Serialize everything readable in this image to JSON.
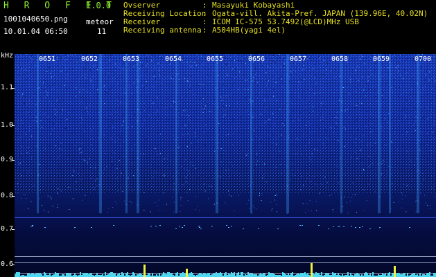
{
  "header_left": {
    "app_title": "H R O F F T",
    "app_version": "1.0.0",
    "file_name": "1001040650.png",
    "meteor_label": "meteor",
    "timestamp": "10.01.04 06:50",
    "meteor_count": "11"
  },
  "header_right": [
    {
      "key": "Ovserver",
      "value": "Masayuki Kobayashi"
    },
    {
      "key": "Receiving Location",
      "value": "Ogata-vill. Akita-Pref. JAPAN (139.96E, 40.02N)"
    },
    {
      "key": "Receiver",
      "value": "ICOM IC-575 53.7492(@LCD)MHz USB"
    },
    {
      "key": "Receiving antenna",
      "value": "A504HB(yagi 4el)"
    }
  ],
  "y_axis": {
    "unit": "kHz",
    "ticks": [
      "1.1",
      "1.0",
      "0.9",
      "0.8",
      "0.7",
      "0.6"
    ]
  },
  "time_axis": {
    "ticks": [
      "0651",
      "0652",
      "0653",
      "0654",
      "0655",
      "0656",
      "0657",
      "0658",
      "0659",
      "0700"
    ]
  },
  "colors": {
    "title_green": "#8ff02e",
    "header_yellow": "#e6e020",
    "spectrum_deep": "#00105a",
    "spectrum_mid": "#1030d0",
    "spectrum_bright": "#30c0ff",
    "echo_yellow": "#f0f040"
  },
  "meteor_echoes": [
    {
      "time": "0653",
      "strength": 0.9
    },
    {
      "time": "0654",
      "strength": 0.6
    },
    {
      "time": "0657",
      "strength": 1.0
    },
    {
      "time": "0659",
      "strength": 0.8
    }
  ]
}
